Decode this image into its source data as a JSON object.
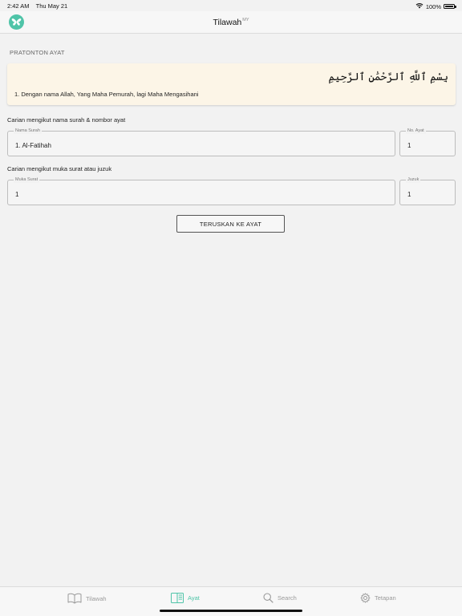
{
  "status_bar": {
    "time": "2:42 AM",
    "date": "Thu May 21",
    "battery_text": "100%",
    "battery_level": 1.0,
    "icons": [
      "wifi-icon",
      "battery-icon"
    ]
  },
  "nav": {
    "title": "Tilawah",
    "title_suffix": "MY",
    "logo_icon": "butterfly-logo-icon",
    "accent_color": "#4fc4a8"
  },
  "preview": {
    "section_label": "PRATONTON AYAT",
    "arabic": "بِسْمِ ٱللَّهِ ٱلرَّحْمَٰنِ ٱلرَّحِيمِ",
    "translation": "1. Dengan nama Allah, Yang Maha Pemurah, lagi Maha Mengasihani",
    "background_color": "#fcf5e7"
  },
  "search_by_surah": {
    "label": "Carian mengikut nama surah & nombor ayat",
    "surah_field": {
      "legend": "Nama Surah",
      "value": "1. Al-Fatihah"
    },
    "ayat_field": {
      "legend": "No. Ayat",
      "value": "1"
    }
  },
  "search_by_page": {
    "label": "Carian mengikut muka surat atau juzuk",
    "page_field": {
      "legend": "Muka Surat",
      "value": "1"
    },
    "juzuk_field": {
      "legend": "Juzuk",
      "value": "1"
    }
  },
  "submit_label": "TERUSKAN KE AYAT",
  "tabs": [
    {
      "label": "Tilawah",
      "icon": "open-book-icon",
      "active": false
    },
    {
      "label": "Ayat",
      "icon": "ayat-book-icon",
      "active": true
    },
    {
      "label": "Search",
      "icon": "search-icon",
      "active": false
    },
    {
      "label": "Tetapan",
      "icon": "gear-icon",
      "active": false
    }
  ]
}
